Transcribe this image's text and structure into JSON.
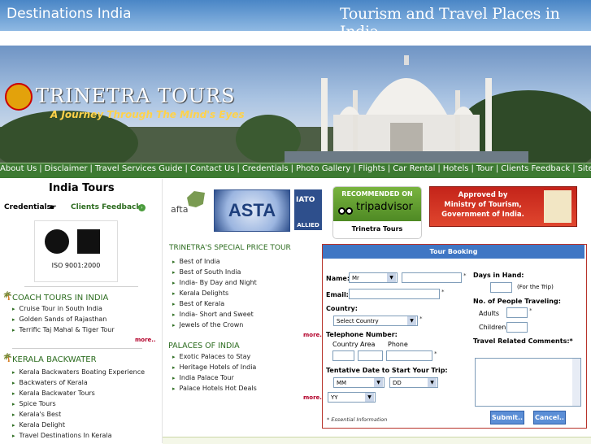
{
  "header": {
    "site_title": "Destinations India",
    "tagline": "Tourism and Travel Places in India"
  },
  "logo": {
    "name": "TRINETRA TOURS",
    "slogan": "A Journey Through The Mind's Eyes"
  },
  "nav": {
    "items": [
      "About Us",
      "Disclaimer",
      "Travel Services Guide",
      "Contact Us",
      "Credentials",
      "Photo Gallery",
      "Flights",
      "Car Rental",
      "Hotels",
      "Tour",
      "Clients Feedback",
      "Site Map"
    ]
  },
  "left": {
    "india_tours": "India Tours",
    "credentials": "Credentials",
    "clients_feedback": "Clients Feedback",
    "iso": "ISO 9001:2000",
    "coach_title": "COACH TOURS IN INDIA",
    "coach_items": [
      "Cruise Tour in South India",
      "Golden Sands of Rajasthan",
      "Terrific Taj Mahal & Tiger Tour"
    ],
    "kerala_title": "KERALA BACKWATER",
    "kerala_items": [
      "Kerala Backwaters Boating Experience",
      "Backwaters of Kerala",
      "Kerala Backwater Tours",
      "Spice Tours",
      "Kerala's Best",
      "Kerala Delight",
      "Travel Destinations In Kerala"
    ],
    "more": "more.."
  },
  "badges": {
    "afta": "afta",
    "asta": "ASTA",
    "iato": "IATO",
    "allied": "ALLIED",
    "recommended_on": "RECOMMENDED ON",
    "tripadvisor": "tripadvisor",
    "trinetra_tours": "Trinetra Tours",
    "approved": "Approved by",
    "ministry": "Ministry of Tourism,",
    "govt": "Government of India."
  },
  "middle": {
    "special_title": "TRINETRA'S SPECIAL PRICE TOUR",
    "special_items": [
      "Best of India",
      "Best of South India",
      "India- By Day and Night",
      "Kerala Delights",
      "Best of Kerala",
      "India- Short and Sweet",
      "Jewels of the Crown"
    ],
    "palaces_title": "PALACES OF INDIA",
    "palaces_items": [
      "Exotic Palaces to Stay",
      "Heritage Hotels of India",
      "India Palace Tour",
      "Palace Hotels Hot Deals"
    ],
    "more": "more.."
  },
  "booking": {
    "title": "Tour Booking",
    "name_label": "Name:",
    "title_value": "Mr",
    "email_label": "Email:",
    "country_label": "Country:",
    "country_value": "Select Country",
    "telephone_label": "Telephone Number:",
    "country_col": "Country",
    "area_col": "Area",
    "phone_col": "Phone",
    "date_label": "Tentative Date to Start Your Trip:",
    "mm": "MM",
    "dd": "DD",
    "yy": "YY",
    "days_label": "Days in Hand:",
    "for_trip": "(For the Trip)",
    "people_label": "No. of People Traveling:",
    "adults": "Adults",
    "children": "Children",
    "comments_label": "Travel Related Comments:*",
    "asterisk": "*",
    "essential": "* Essential Information",
    "submit": "Submit..",
    "cancel": "Cancel.."
  },
  "colors": {
    "nav_green": "#3d7a32",
    "header_blue": "#4a86c6",
    "booking_border": "#b8332a",
    "booking_head": "#3f76c4"
  }
}
